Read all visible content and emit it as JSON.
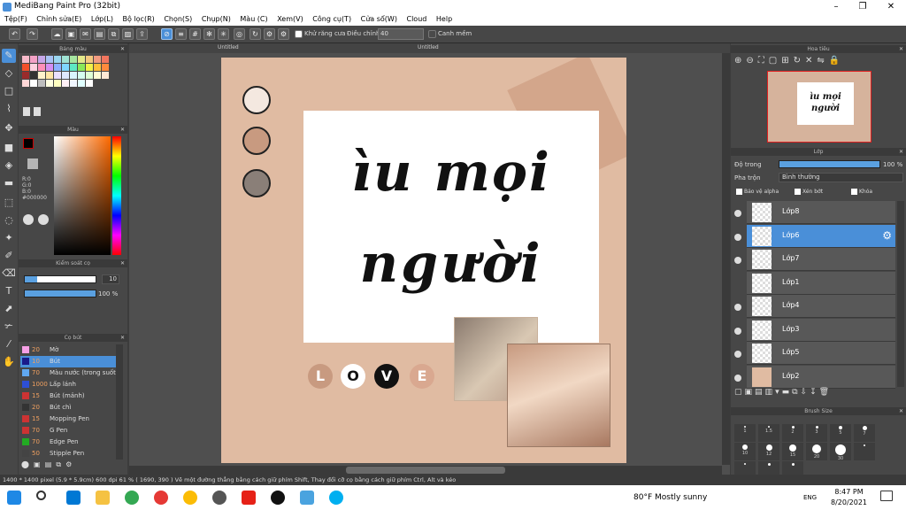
{
  "window": {
    "title": "MediBang Paint Pro (32bit)"
  },
  "menu": [
    "Tệp(F)",
    "Chỉnh sửa(E)",
    "Lớp(L)",
    "Bộ lọc(R)",
    "Chọn(S)",
    "Chụp(N)",
    "Màu (C)",
    "Xem(V)",
    "Công cụ(T)",
    "Cửa sổ(W)",
    "Cloud",
    "Help"
  ],
  "toolbar": {
    "antialias_label": "Khử răng cưa",
    "adjust_label": "Điều chỉnh",
    "adjust_value": "40",
    "smooth_label": "Canh mềm"
  },
  "panels": {
    "palette": "Bảng màu",
    "color": "Màu",
    "brush_control": "Kiểm soát cọ",
    "brush": "Cọ bút",
    "navigator": "Hoa tiêu",
    "layer": "Lớp",
    "brush_size": "Brush Size"
  },
  "color": {
    "r": "R:0",
    "g": "G:0",
    "b": "B:0",
    "hex": "#000000"
  },
  "brush_control": {
    "size": "10",
    "opacity": "100 %"
  },
  "brushes": [
    {
      "size": "20",
      "name": "Mờ",
      "color": "#f6a0e6"
    },
    {
      "size": "10",
      "name": "Bút",
      "color": "#1a1a8a",
      "selected": true
    },
    {
      "size": "70",
      "name": "Màu nước (trong suốt)",
      "color": "#60a8f0"
    },
    {
      "size": "1000",
      "name": "Lấp lánh",
      "color": "#2d4fd6"
    },
    {
      "size": "15",
      "name": "Bút (mảnh)",
      "color": "#cc3333"
    },
    {
      "size": "20",
      "name": "Bút chì",
      "color": "#333333"
    },
    {
      "size": "15",
      "name": "Mopping Pen",
      "color": "#cc3333"
    },
    {
      "size": "70",
      "name": "G Pen",
      "color": "#cc3333"
    },
    {
      "size": "70",
      "name": "Edge Pen",
      "color": "#22aa22"
    },
    {
      "size": "50",
      "name": "Stipple Pen",
      "color": "#444444"
    }
  ],
  "tabs": [
    "Untitled",
    "Untitled"
  ],
  "canvas": {
    "line1": "ìu mọi",
    "line2": "người",
    "love": [
      "L",
      "O",
      "V",
      "E"
    ]
  },
  "layer_panel": {
    "opacity_label": "Độ trong",
    "opacity_value": "100 %",
    "blend_label": "Pha trộn",
    "blend_value": "Bình thường",
    "protect_alpha": "Bảo vệ alpha",
    "clipping": "Xén bớt",
    "lock": "Khóa"
  },
  "layers": [
    "Lớp8",
    "Lớp6",
    "Lớp7",
    "Lớp1",
    "Lớp4",
    "Lớp3",
    "Lớp5",
    "Lớp2"
  ],
  "brush_sizes": [
    "1",
    "1.5",
    "2",
    "3",
    "5",
    "7",
    "10",
    "12",
    "15",
    "20",
    "30"
  ],
  "navigator": {
    "line1": "ìu mọi",
    "line2": "người"
  },
  "status": "1400 * 1400 pixel   (5.9 * 5.9cm)  600 dpi   61 %   ( 1690, 390 )   Vẽ một đường thẳng bằng cách giữ phím Shift, Thay đổi cỡ cọ bằng cách giữ phím Ctrl, Alt và kéo",
  "taskbar": {
    "weather": "80°F  Mostly sunny",
    "lang": "ENG",
    "time": "8:47 PM",
    "date": "8/20/2021"
  }
}
